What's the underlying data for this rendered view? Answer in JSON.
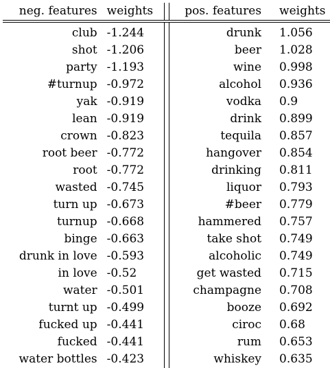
{
  "table": {
    "headers": {
      "neg_features": "neg. features",
      "neg_weights": "weights",
      "pos_features": "pos. features",
      "pos_weights": "weights"
    },
    "rows": [
      {
        "neg": "club",
        "neg_w": "-1.244",
        "pos": "drunk",
        "pos_w": "1.056"
      },
      {
        "neg": "shot",
        "neg_w": "-1.206",
        "pos": "beer",
        "pos_w": "1.028"
      },
      {
        "neg": "party",
        "neg_w": "-1.193",
        "pos": "wine",
        "pos_w": "0.998"
      },
      {
        "neg": "#turnup",
        "neg_w": "-0.972",
        "pos": "alcohol",
        "pos_w": "0.936"
      },
      {
        "neg": "yak",
        "neg_w": "-0.919",
        "pos": "vodka",
        "pos_w": "0.9"
      },
      {
        "neg": "lean",
        "neg_w": "-0.919",
        "pos": "drink",
        "pos_w": "0.899"
      },
      {
        "neg": "crown",
        "neg_w": "-0.823",
        "pos": "tequila",
        "pos_w": "0.857"
      },
      {
        "neg": "root beer",
        "neg_w": "-0.772",
        "pos": "hangover",
        "pos_w": "0.854"
      },
      {
        "neg": "root",
        "neg_w": "-0.772",
        "pos": "drinking",
        "pos_w": "0.811"
      },
      {
        "neg": "wasted",
        "neg_w": "-0.745",
        "pos": "liquor",
        "pos_w": "0.793"
      },
      {
        "neg": "turn up",
        "neg_w": "-0.673",
        "pos": "#beer",
        "pos_w": "0.779"
      },
      {
        "neg": "turnup",
        "neg_w": "-0.668",
        "pos": "hammered",
        "pos_w": "0.757"
      },
      {
        "neg": "binge",
        "neg_w": "-0.663",
        "pos": "take shot",
        "pos_w": "0.749"
      },
      {
        "neg": "drunk in love",
        "neg_w": "-0.593",
        "pos": "alcoholic",
        "pos_w": "0.749"
      },
      {
        "neg": "in love",
        "neg_w": "-0.52",
        "pos": "get wasted",
        "pos_w": "0.715"
      },
      {
        "neg": "water",
        "neg_w": "-0.501",
        "pos": "champagne",
        "pos_w": "0.708"
      },
      {
        "neg": "turnt up",
        "neg_w": "-0.499",
        "pos": "booze",
        "pos_w": "0.692"
      },
      {
        "neg": "fucked up",
        "neg_w": "-0.441",
        "pos": "ciroc",
        "pos_w": "0.68"
      },
      {
        "neg": "fucked",
        "neg_w": "-0.441",
        "pos": "rum",
        "pos_w": "0.653"
      },
      {
        "neg": "water bottles",
        "neg_w": "-0.423",
        "pos": "whiskey",
        "pos_w": "0.635"
      }
    ]
  }
}
